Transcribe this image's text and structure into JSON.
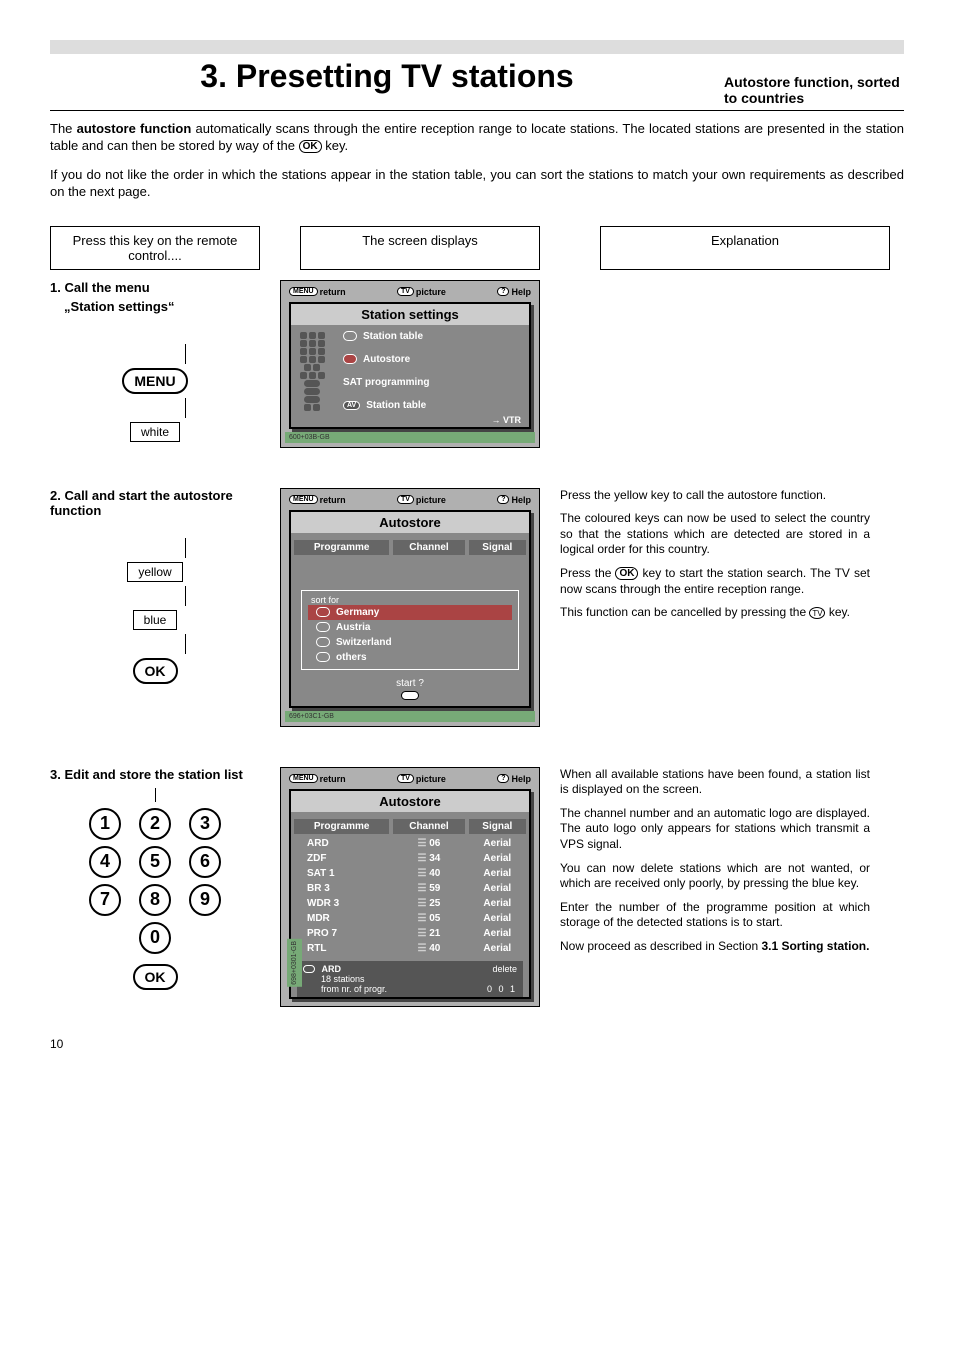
{
  "pageNumber": "10",
  "header": {
    "title": "3. Presetting TV stations",
    "subtitle": "Autostore function, sorted to countries"
  },
  "intro": {
    "p1a": "The ",
    "p1b": "autostore function",
    "p1c": " automatically scans through the entire reception range to locate stations. The located stations are presented in the station table and can then be stored by way of the ",
    "p1d": " key.",
    "p2": "If you do not like the order in which the stations appear in the station table, you can sort the stations to match your own requirements as described on the next page."
  },
  "colHeaders": {
    "c1": "Press this key on the remote control....",
    "c2": "The screen displays",
    "c3": "Explanation"
  },
  "step1": {
    "title": "1. Call the menu",
    "subtitle": "„Station settings“",
    "menuBtn": "MENU",
    "whiteLabel": "white",
    "osd": {
      "return": "return",
      "picture": "picture",
      "help": "Help",
      "title": "Station settings",
      "items": [
        "Station table",
        "Autostore",
        "SAT programming",
        "Station table"
      ],
      "vtr": "→  VTR",
      "code": "600+03B-GB"
    }
  },
  "step2": {
    "title": "2. Call and start the autostore function",
    "yellow": "yellow",
    "blue": "blue",
    "okBtn": "OK",
    "osd": {
      "return": "return",
      "picture": "picture",
      "help": "Help",
      "title": "Autostore",
      "th1": "Programme",
      "th2": "Channel",
      "th3": "Signal",
      "sortLabel": "sort for",
      "countries": [
        "Germany",
        "Austria",
        "Switzerland",
        "others"
      ],
      "start": "start ?",
      "startKey": "OK",
      "code": "696+03C1-GB"
    },
    "expl": {
      "p1": "Press the yellow key to call the autostore function.",
      "p2": "The coloured keys can now be used to select the country so that the stations which are detected are stored in a logical order for this country.",
      "p3a": "Press the ",
      "p3b": " key to start the station search. The TV set now scans through the entire reception range.",
      "p4a": "This function can be cancelled by pressing the ",
      "p4b": " key."
    }
  },
  "step3": {
    "title": "3. Edit and store the station list",
    "keys": [
      "1",
      "2",
      "3",
      "4",
      "5",
      "6",
      "7",
      "8",
      "9",
      "0"
    ],
    "okBtn": "OK",
    "osd": {
      "return": "return",
      "picture": "picture",
      "help": "Help",
      "title": "Autostore",
      "th1": "Programme",
      "th2": "Channel",
      "th3": "Signal",
      "rows": [
        {
          "p": "ARD",
          "c": "06",
          "s": "Aerial"
        },
        {
          "p": "ZDF",
          "c": "34",
          "s": "Aerial"
        },
        {
          "p": "SAT 1",
          "c": "40",
          "s": "Aerial"
        },
        {
          "p": "BR 3",
          "c": "59",
          "s": "Aerial"
        },
        {
          "p": "WDR 3",
          "c": "25",
          "s": "Aerial"
        },
        {
          "p": "MDR",
          "c": "05",
          "s": "Aerial"
        },
        {
          "p": "PRO 7",
          "c": "21",
          "s": "Aerial"
        },
        {
          "p": "RTL",
          "c": "40",
          "s": "Aerial"
        }
      ],
      "footSel": "ARD",
      "footDel": "delete",
      "footCount": "18 stations",
      "footFrom": "from nr. of progr.",
      "footNum": "0 0 1",
      "code": "698+0301-GB"
    },
    "expl": {
      "p1": "When all available stations have been found, a station list is displayed on the screen.",
      "p2": "The channel number and an automatic logo are displayed. The auto logo only appears for stations which transmit a VPS signal.",
      "p3": "You can now delete stations which are not wanted, or which are received only poorly, by pressing the blue key.",
      "p4": "Enter the number of the programme position at which storage of the detected stations is to start.",
      "p5a": "Now proceed as described in Section ",
      "p5b": "3.1 Sorting station."
    }
  },
  "inlineKeys": {
    "ok": "OK",
    "tv": "TV",
    "menu": "MENU",
    "help": "?",
    "av": "AV"
  }
}
